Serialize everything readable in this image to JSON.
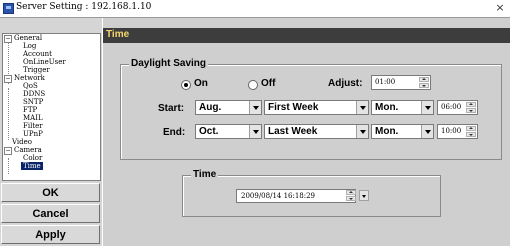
{
  "window": {
    "title": "Server Setting : 192.168.1.10",
    "close": "×"
  },
  "tree": {
    "general": "General",
    "log": "Log",
    "account": "Account",
    "online_user": "OnLineUser",
    "trigger": "Trigger",
    "network": "Network",
    "qos": "QoS",
    "ddns": "DDNS",
    "sntp": "SNTP",
    "ftp": "FTP",
    "mail": "MAIL",
    "filter": "Filter",
    "upnp": "UPnP",
    "video": "Video",
    "camera": "Camera",
    "color": "Color",
    "time": "Time",
    "expand_sign": "−"
  },
  "buttons": {
    "ok": "OK",
    "cancel": "Cancel",
    "apply": "Apply"
  },
  "header": {
    "title": "Time"
  },
  "daylight": {
    "title": "Daylight Saving",
    "on_label": "On",
    "off_label": "Off",
    "on_selected": true,
    "adjust_label": "Adjust:",
    "adjust_value": "01:00",
    "start_label": "Start:",
    "start_month": "Aug.",
    "start_week": "First Week",
    "start_day": "Mon.",
    "start_time": "06:00",
    "end_label": "End:",
    "end_month": "Oct.",
    "end_week": "Last Week",
    "end_day": "Mon.",
    "end_time": "10:00"
  },
  "time": {
    "title": "Time",
    "datetime": "2009/08/14 16:18:29"
  },
  "colors": {
    "header_bg": "#3d3d3d",
    "header_text": "#f5d76e",
    "selected_bg": "#0a246a",
    "panel_bg": "#cfcfcf"
  }
}
